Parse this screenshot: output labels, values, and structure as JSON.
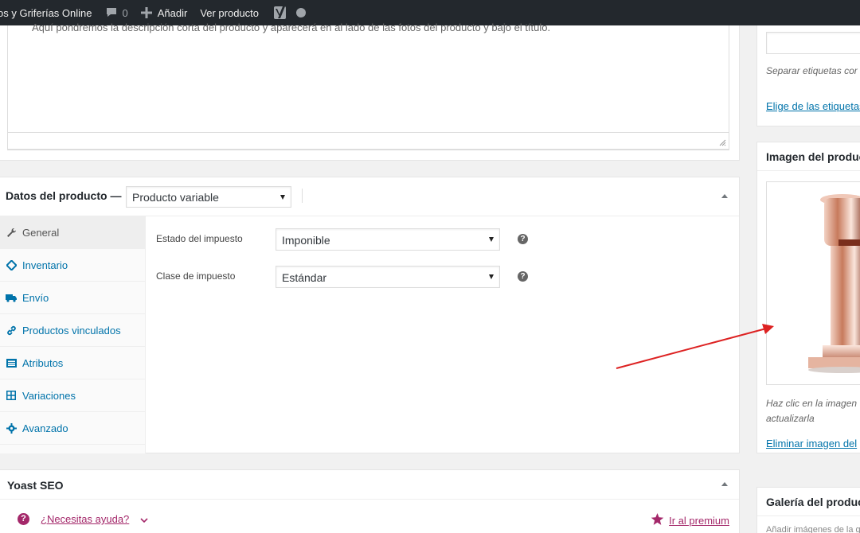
{
  "adminbar": {
    "site_name": "os y Griferías Online",
    "comments_count": "0",
    "new_label": "Añadir",
    "view_label": "Ver producto"
  },
  "description": {
    "text": "Aquí pondremos la descripción corta del producto y aparecerá en al lado de las fotos del producto y bajo el título."
  },
  "product_data": {
    "title": "Datos del producto —",
    "type_selected": "Producto variable",
    "tabs": [
      {
        "label": "General",
        "icon": "wrench-icon"
      },
      {
        "label": "Inventario",
        "icon": "tag-icon"
      },
      {
        "label": "Envío",
        "icon": "truck-icon"
      },
      {
        "label": "Productos vinculados",
        "icon": "link-icon"
      },
      {
        "label": "Atributos",
        "icon": "list-icon"
      },
      {
        "label": "Variaciones",
        "icon": "grid-icon"
      },
      {
        "label": "Avanzado",
        "icon": "gear-icon"
      }
    ],
    "fields": [
      {
        "label": "Estado del impuesto",
        "value": "Imponible"
      },
      {
        "label": "Clase de impuesto",
        "value": "Estándar"
      }
    ]
  },
  "yoast": {
    "title": "Yoast SEO",
    "help_link": "¿Necesitas ayuda?",
    "premium_link": "Ir al premium"
  },
  "sidebar": {
    "tags_hint": "Separar etiquetas cor",
    "tags_link": "Elige de las etiquetas",
    "image_title": "Imagen del produc",
    "image_hint": "Haz clic en la imagen actualizarla",
    "image_remove": "Eliminar imagen del",
    "gallery_title": "Galería del product",
    "gallery_sub": "Añadir imágenes de la galería"
  },
  "colors": {
    "adminbar_bg": "#23282d",
    "link": "#0073aa",
    "yoast_accent": "#a4286a",
    "arrow": "#dd2222"
  }
}
